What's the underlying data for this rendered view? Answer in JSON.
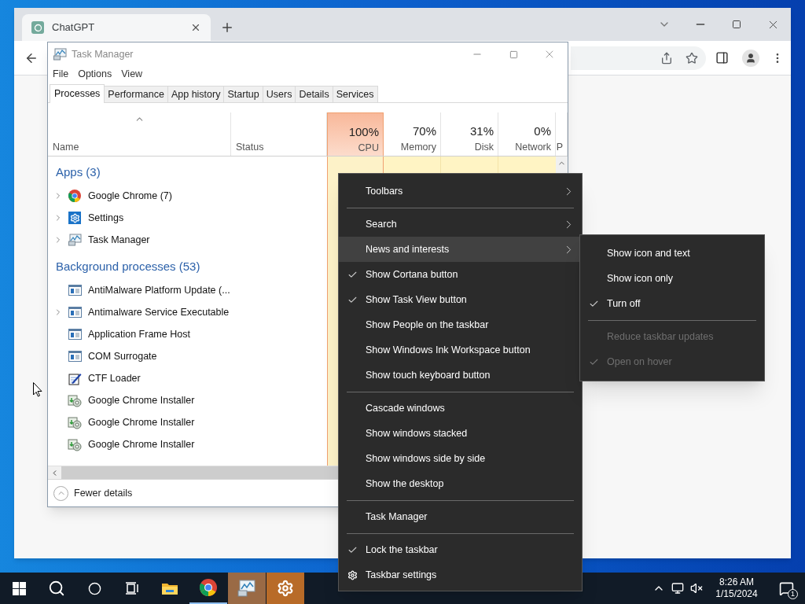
{
  "browser": {
    "tab_title": "ChatGPT"
  },
  "task_manager": {
    "title": "Task Manager",
    "menu": [
      "File",
      "Options",
      "View"
    ],
    "tabs": [
      {
        "label": "Processes",
        "selected": true
      },
      {
        "label": "Performance",
        "selected": false
      },
      {
        "label": "App history",
        "selected": false
      },
      {
        "label": "Startup",
        "selected": false
      },
      {
        "label": "Users",
        "selected": false
      },
      {
        "label": "Details",
        "selected": false
      },
      {
        "label": "Services",
        "selected": false
      }
    ],
    "columns": [
      {
        "label": "Name",
        "sorted": true,
        "highlighted": false
      },
      {
        "label": "Status",
        "sorted": false,
        "highlighted": false
      },
      {
        "reading": "100%",
        "label": "CPU",
        "sorted": false,
        "highlighted": true
      },
      {
        "reading": "70%",
        "label": "Memory",
        "sorted": false,
        "highlighted": false
      },
      {
        "reading": "31%",
        "label": "Disk",
        "sorted": false,
        "highlighted": false
      },
      {
        "reading": "0%",
        "label": "Network",
        "sorted": false,
        "highlighted": false
      },
      {
        "label": "P",
        "highlighted": false
      }
    ],
    "groups": [
      {
        "title": "Apps (3)",
        "rows": [
          {
            "name": "Google Chrome (7)",
            "kind": "chrome",
            "expandable": true
          },
          {
            "name": "Settings",
            "kind": "settings",
            "expandable": true
          },
          {
            "name": "Task Manager",
            "kind": "taskmgr",
            "expandable": true
          }
        ]
      },
      {
        "title": "Background processes (53)",
        "rows": [
          {
            "name": "AntiMalware Platform Update (...",
            "kind": "service",
            "expandable": false
          },
          {
            "name": "Antimalware Service Executable",
            "kind": "service",
            "expandable": true
          },
          {
            "name": "Application Frame Host",
            "kind": "service",
            "expandable": false
          },
          {
            "name": "COM Surrogate",
            "kind": "service",
            "expandable": false
          },
          {
            "name": "CTF Loader",
            "kind": "ctf",
            "expandable": false
          },
          {
            "name": "Google Chrome Installer",
            "kind": "installer",
            "expandable": false
          },
          {
            "name": "Google Chrome Installer",
            "kind": "installer",
            "expandable": false
          },
          {
            "name": "Google Chrome Installer",
            "kind": "installer",
            "expandable": false
          }
        ]
      }
    ],
    "footer": "Fewer details"
  },
  "context_menu": {
    "sections": [
      [
        {
          "label": "Toolbars",
          "kind": "submenu",
          "checked": false,
          "selected": false
        }
      ],
      [
        {
          "label": "Search",
          "kind": "submenu",
          "checked": false,
          "selected": false
        },
        {
          "label": "News and interests",
          "kind": "submenu",
          "checked": false,
          "selected": true
        },
        {
          "label": "Show Cortana button",
          "kind": "toggle",
          "checked": true,
          "selected": false
        },
        {
          "label": "Show Task View button",
          "kind": "toggle",
          "checked": true,
          "selected": false
        },
        {
          "label": "Show People on the taskbar",
          "kind": "toggle",
          "checked": false,
          "selected": false
        },
        {
          "label": "Show Windows Ink Workspace button",
          "kind": "toggle",
          "checked": false,
          "selected": false
        },
        {
          "label": "Show touch keyboard button",
          "kind": "toggle",
          "checked": false,
          "selected": false
        }
      ],
      [
        {
          "label": "Cascade windows",
          "kind": "command",
          "checked": false,
          "selected": false
        },
        {
          "label": "Show windows stacked",
          "kind": "command",
          "checked": false,
          "selected": false
        },
        {
          "label": "Show windows side by side",
          "kind": "command",
          "checked": false,
          "selected": false
        },
        {
          "label": "Show the desktop",
          "kind": "command",
          "checked": false,
          "selected": false
        }
      ],
      [
        {
          "label": "Task Manager",
          "kind": "command",
          "checked": false,
          "selected": false
        }
      ],
      [
        {
          "label": "Lock the taskbar",
          "kind": "toggle",
          "checked": true,
          "selected": false
        },
        {
          "label": "Taskbar settings",
          "kind": "settings",
          "checked": false,
          "selected": false
        }
      ]
    ]
  },
  "submenu": {
    "sections": [
      [
        {
          "label": "Show icon and text",
          "checked": false,
          "disabled": false
        },
        {
          "label": "Show icon only",
          "checked": false,
          "disabled": false
        },
        {
          "label": "Turn off",
          "checked": true,
          "disabled": false
        }
      ],
      [
        {
          "label": "Reduce taskbar updates",
          "checked": false,
          "disabled": true
        },
        {
          "label": "Open on hover",
          "checked": true,
          "disabled": true
        }
      ]
    ]
  },
  "taskbar": {
    "apps": [
      {
        "kind": "explorer",
        "running": false,
        "flashing": false
      },
      {
        "kind": "chrome",
        "running": true,
        "flashing": false
      },
      {
        "kind": "taskmgr",
        "running": false,
        "flashing": true
      },
      {
        "kind": "settings",
        "running": false,
        "flashing": true
      }
    ],
    "time": "8:26 AM",
    "date": "1/15/2024",
    "notifications": "1"
  }
}
